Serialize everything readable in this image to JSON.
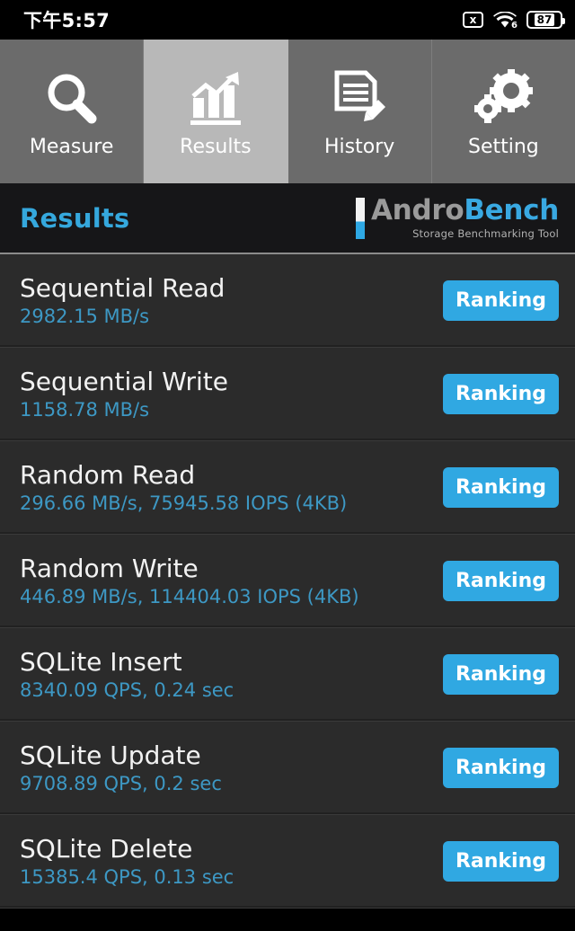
{
  "statusbar": {
    "time": "下午5:57",
    "sim_icon_label": "x",
    "wifi_generation": "6",
    "battery_percent": "87"
  },
  "tabs": [
    {
      "label": "Measure",
      "icon": "magnifier-icon",
      "selected": false
    },
    {
      "label": "Results",
      "icon": "bar-chart-arrow-icon",
      "selected": true
    },
    {
      "label": "History",
      "icon": "document-pencil-icon",
      "selected": false
    },
    {
      "label": "Setting",
      "icon": "gears-icon",
      "selected": false
    }
  ],
  "header": {
    "page_title": "Results",
    "logo_first": "Andro",
    "logo_second": "Bench",
    "logo_tagline": "Storage Benchmarking Tool"
  },
  "colors": {
    "accent_blue": "#30a8e2",
    "title_blue": "#35a8dd",
    "value_blue": "#3d98c4",
    "tab_unselected": "#6b6b6b",
    "tab_selected": "#b8b8b8",
    "list_background": "#2b2b2b",
    "header_background": "#161618"
  },
  "results": {
    "button_label": "Ranking",
    "rows": [
      {
        "title": "Sequential Read",
        "value": "2982.15 MB/s"
      },
      {
        "title": "Sequential Write",
        "value": "1158.78 MB/s"
      },
      {
        "title": "Random Read",
        "value": "296.66 MB/s, 75945.58 IOPS (4KB)"
      },
      {
        "title": "Random Write",
        "value": "446.89 MB/s, 114404.03 IOPS (4KB)"
      },
      {
        "title": "SQLite Insert",
        "value": "8340.09 QPS, 0.24 sec"
      },
      {
        "title": "SQLite Update",
        "value": "9708.89 QPS, 0.2 sec"
      },
      {
        "title": "SQLite Delete",
        "value": "15385.4 QPS, 0.13 sec"
      }
    ]
  }
}
